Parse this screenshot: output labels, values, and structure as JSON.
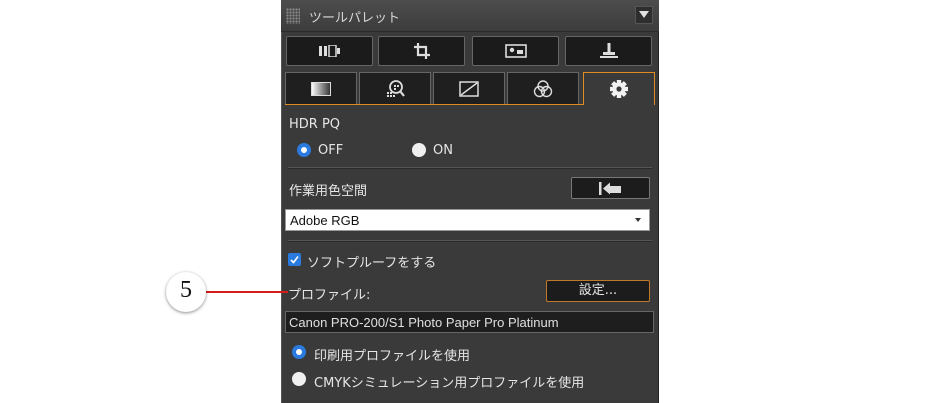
{
  "panel": {
    "title": "ツールパレット",
    "tool_buttons": [
      "adjust-tool-icon",
      "crop-tool-icon",
      "image-view-icon",
      "stamp-tool-icon"
    ],
    "tabs": [
      "basic-adjust-tab-icon",
      "sharpness-tab-icon",
      "tone-curve-tab-icon",
      "color-tab-icon",
      "settings-gear-icon"
    ],
    "active_tab_index": 4
  },
  "hdr": {
    "label": "HDR PQ",
    "off_label": "OFF",
    "on_label": "ON",
    "selected": "OFF"
  },
  "color_space": {
    "label": "作業用色空間",
    "reset_icon": "revert-icon",
    "selected": "Adobe RGB"
  },
  "soft_proof": {
    "checkbox_label": "ソフトプルーフをする",
    "checked": true,
    "profile_label": "プロファイル:",
    "settings_button": "設定...",
    "profile_value": "Canon PRO-200/S1 Photo Paper Pro Platinum",
    "option_print": "印刷用プロファイルを使用",
    "option_cmyk": "CMYKシミュレーション用プロファイルを使用",
    "selected_option": "print"
  },
  "callout": {
    "number": "5",
    "line_color": "#d61b1b"
  },
  "colors": {
    "accent_orange": "#e08a22",
    "radio_blue": "#2a7ae0",
    "panel_bg": "#3a3a3a"
  }
}
